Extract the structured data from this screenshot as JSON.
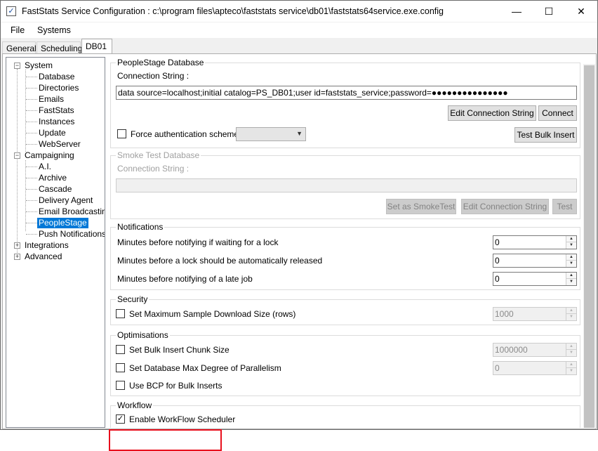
{
  "window": {
    "title": "FastStats Service Configuration : c:\\program files\\apteco\\faststats service\\db01\\faststats64service.exe.config",
    "app_icon": "checkmark-icon",
    "controls": {
      "minimize": "—",
      "maximize": "☐",
      "close": "✕"
    }
  },
  "menu": {
    "items": [
      "File",
      "Systems"
    ]
  },
  "tabs": [
    "General",
    "Scheduling",
    "DB01"
  ],
  "active_tab": "DB01",
  "tree": {
    "system": {
      "label": "System",
      "expander": "−",
      "children": [
        "Database",
        "Directories",
        "Emails",
        "FastStats",
        "Instances",
        "Update",
        "WebServer"
      ]
    },
    "campaigning": {
      "label": "Campaigning",
      "expander": "−",
      "children": [
        "A.I.",
        "Archive",
        "Cascade",
        "Delivery Agent",
        "Email Broadcasting",
        "PeopleStage",
        "Push Notifications"
      ]
    },
    "integrations": {
      "label": "Integrations",
      "expander": "+"
    },
    "advanced": {
      "label": "Advanced",
      "expander": "+"
    },
    "selected": "PeopleStage"
  },
  "peoplestage_db": {
    "title": "PeopleStage Database",
    "conn_label": "Connection String :",
    "conn_value": "data source=localhost;initial catalog=PS_DB01;user id=faststats_service;password=●●●●●●●●●●●●●●●",
    "edit_btn": "Edit Connection String",
    "connect_btn": "Connect",
    "force_auth_label": "Force authentication scheme",
    "force_auth_checked": false,
    "auth_select_value": "",
    "test_bulk_btn": "Test Bulk Insert"
  },
  "smoke_test": {
    "title": "Smoke Test Database",
    "conn_label": "Connection String :",
    "conn_value": "",
    "set_btn": "Set as SmokeTest",
    "edit_btn": "Edit Connection String",
    "test_btn": "Test"
  },
  "notifications": {
    "title": "Notifications",
    "rows": [
      {
        "label": "Minutes before notifying if waiting for a lock",
        "value": "0"
      },
      {
        "label": "Minutes before a lock should be automatically released",
        "value": "0"
      },
      {
        "label": "Minutes before notifying of a late job",
        "value": "0"
      }
    ]
  },
  "security": {
    "title": "Security",
    "max_sample_label": "Set Maximum Sample Download Size (rows)",
    "max_sample_checked": false,
    "max_sample_value": "1000"
  },
  "optimisations": {
    "title": "Optimisations",
    "chunk_label": "Set Bulk Insert Chunk Size",
    "chunk_checked": false,
    "chunk_value": "1000000",
    "parallel_label": "Set Database Max Degree of Parallelism",
    "parallel_checked": false,
    "parallel_value": "0",
    "bcp_label": "Use BCP for Bulk Inserts",
    "bcp_checked": false
  },
  "workflow": {
    "title": "Workflow",
    "scheduler_label": "Enable WorkFlow Scheduler",
    "scheduler_checked": true
  },
  "glyphs": {
    "check": "✓",
    "unchecked": "",
    "dropdown": "▼",
    "spin_up": "▲",
    "spin_down": "▼"
  },
  "colors": {
    "highlight": "#e8101d",
    "selection": "#0078d7"
  }
}
